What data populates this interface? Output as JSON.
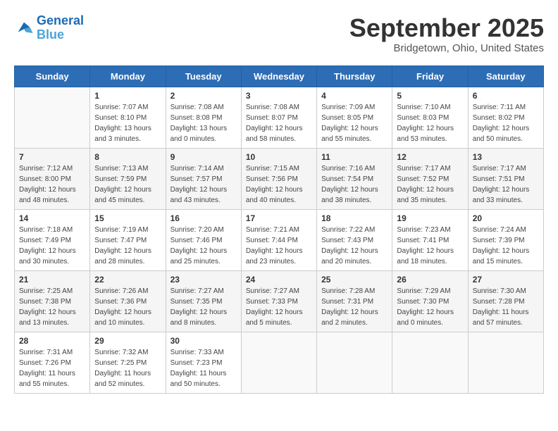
{
  "logo": {
    "line1": "General",
    "line2": "Blue"
  },
  "title": "September 2025",
  "location": "Bridgetown, Ohio, United States",
  "weekdays": [
    "Sunday",
    "Monday",
    "Tuesday",
    "Wednesday",
    "Thursday",
    "Friday",
    "Saturday"
  ],
  "weeks": [
    [
      {
        "day": "",
        "sunrise": "",
        "sunset": "",
        "daylight": ""
      },
      {
        "day": "1",
        "sunrise": "Sunrise: 7:07 AM",
        "sunset": "Sunset: 8:10 PM",
        "daylight": "Daylight: 13 hours and 3 minutes."
      },
      {
        "day": "2",
        "sunrise": "Sunrise: 7:08 AM",
        "sunset": "Sunset: 8:08 PM",
        "daylight": "Daylight: 13 hours and 0 minutes."
      },
      {
        "day": "3",
        "sunrise": "Sunrise: 7:08 AM",
        "sunset": "Sunset: 8:07 PM",
        "daylight": "Daylight: 12 hours and 58 minutes."
      },
      {
        "day": "4",
        "sunrise": "Sunrise: 7:09 AM",
        "sunset": "Sunset: 8:05 PM",
        "daylight": "Daylight: 12 hours and 55 minutes."
      },
      {
        "day": "5",
        "sunrise": "Sunrise: 7:10 AM",
        "sunset": "Sunset: 8:03 PM",
        "daylight": "Daylight: 12 hours and 53 minutes."
      },
      {
        "day": "6",
        "sunrise": "Sunrise: 7:11 AM",
        "sunset": "Sunset: 8:02 PM",
        "daylight": "Daylight: 12 hours and 50 minutes."
      }
    ],
    [
      {
        "day": "7",
        "sunrise": "Sunrise: 7:12 AM",
        "sunset": "Sunset: 8:00 PM",
        "daylight": "Daylight: 12 hours and 48 minutes."
      },
      {
        "day": "8",
        "sunrise": "Sunrise: 7:13 AM",
        "sunset": "Sunset: 7:59 PM",
        "daylight": "Daylight: 12 hours and 45 minutes."
      },
      {
        "day": "9",
        "sunrise": "Sunrise: 7:14 AM",
        "sunset": "Sunset: 7:57 PM",
        "daylight": "Daylight: 12 hours and 43 minutes."
      },
      {
        "day": "10",
        "sunrise": "Sunrise: 7:15 AM",
        "sunset": "Sunset: 7:56 PM",
        "daylight": "Daylight: 12 hours and 40 minutes."
      },
      {
        "day": "11",
        "sunrise": "Sunrise: 7:16 AM",
        "sunset": "Sunset: 7:54 PM",
        "daylight": "Daylight: 12 hours and 38 minutes."
      },
      {
        "day": "12",
        "sunrise": "Sunrise: 7:17 AM",
        "sunset": "Sunset: 7:52 PM",
        "daylight": "Daylight: 12 hours and 35 minutes."
      },
      {
        "day": "13",
        "sunrise": "Sunrise: 7:17 AM",
        "sunset": "Sunset: 7:51 PM",
        "daylight": "Daylight: 12 hours and 33 minutes."
      }
    ],
    [
      {
        "day": "14",
        "sunrise": "Sunrise: 7:18 AM",
        "sunset": "Sunset: 7:49 PM",
        "daylight": "Daylight: 12 hours and 30 minutes."
      },
      {
        "day": "15",
        "sunrise": "Sunrise: 7:19 AM",
        "sunset": "Sunset: 7:47 PM",
        "daylight": "Daylight: 12 hours and 28 minutes."
      },
      {
        "day": "16",
        "sunrise": "Sunrise: 7:20 AM",
        "sunset": "Sunset: 7:46 PM",
        "daylight": "Daylight: 12 hours and 25 minutes."
      },
      {
        "day": "17",
        "sunrise": "Sunrise: 7:21 AM",
        "sunset": "Sunset: 7:44 PM",
        "daylight": "Daylight: 12 hours and 23 minutes."
      },
      {
        "day": "18",
        "sunrise": "Sunrise: 7:22 AM",
        "sunset": "Sunset: 7:43 PM",
        "daylight": "Daylight: 12 hours and 20 minutes."
      },
      {
        "day": "19",
        "sunrise": "Sunrise: 7:23 AM",
        "sunset": "Sunset: 7:41 PM",
        "daylight": "Daylight: 12 hours and 18 minutes."
      },
      {
        "day": "20",
        "sunrise": "Sunrise: 7:24 AM",
        "sunset": "Sunset: 7:39 PM",
        "daylight": "Daylight: 12 hours and 15 minutes."
      }
    ],
    [
      {
        "day": "21",
        "sunrise": "Sunrise: 7:25 AM",
        "sunset": "Sunset: 7:38 PM",
        "daylight": "Daylight: 12 hours and 13 minutes."
      },
      {
        "day": "22",
        "sunrise": "Sunrise: 7:26 AM",
        "sunset": "Sunset: 7:36 PM",
        "daylight": "Daylight: 12 hours and 10 minutes."
      },
      {
        "day": "23",
        "sunrise": "Sunrise: 7:27 AM",
        "sunset": "Sunset: 7:35 PM",
        "daylight": "Daylight: 12 hours and 8 minutes."
      },
      {
        "day": "24",
        "sunrise": "Sunrise: 7:27 AM",
        "sunset": "Sunset: 7:33 PM",
        "daylight": "Daylight: 12 hours and 5 minutes."
      },
      {
        "day": "25",
        "sunrise": "Sunrise: 7:28 AM",
        "sunset": "Sunset: 7:31 PM",
        "daylight": "Daylight: 12 hours and 2 minutes."
      },
      {
        "day": "26",
        "sunrise": "Sunrise: 7:29 AM",
        "sunset": "Sunset: 7:30 PM",
        "daylight": "Daylight: 12 hours and 0 minutes."
      },
      {
        "day": "27",
        "sunrise": "Sunrise: 7:30 AM",
        "sunset": "Sunset: 7:28 PM",
        "daylight": "Daylight: 11 hours and 57 minutes."
      }
    ],
    [
      {
        "day": "28",
        "sunrise": "Sunrise: 7:31 AM",
        "sunset": "Sunset: 7:26 PM",
        "daylight": "Daylight: 11 hours and 55 minutes."
      },
      {
        "day": "29",
        "sunrise": "Sunrise: 7:32 AM",
        "sunset": "Sunset: 7:25 PM",
        "daylight": "Daylight: 11 hours and 52 minutes."
      },
      {
        "day": "30",
        "sunrise": "Sunrise: 7:33 AM",
        "sunset": "Sunset: 7:23 PM",
        "daylight": "Daylight: 11 hours and 50 minutes."
      },
      {
        "day": "",
        "sunrise": "",
        "sunset": "",
        "daylight": ""
      },
      {
        "day": "",
        "sunrise": "",
        "sunset": "",
        "daylight": ""
      },
      {
        "day": "",
        "sunrise": "",
        "sunset": "",
        "daylight": ""
      },
      {
        "day": "",
        "sunrise": "",
        "sunset": "",
        "daylight": ""
      }
    ]
  ]
}
